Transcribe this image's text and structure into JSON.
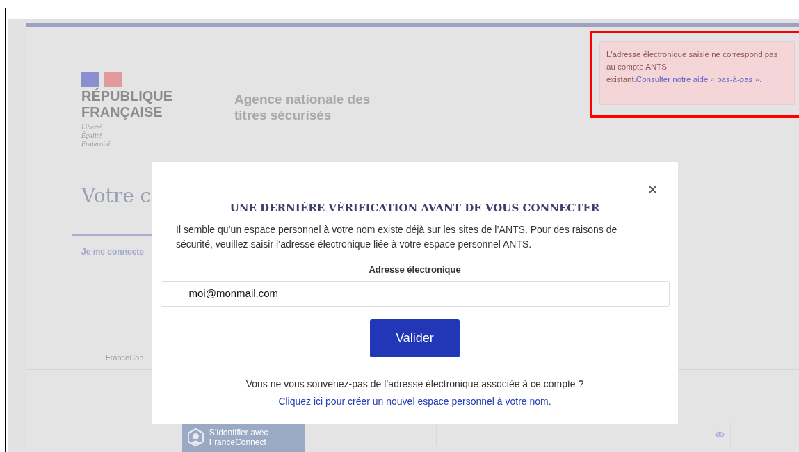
{
  "background_page": {
    "logo": {
      "name": "RÉPUBLIQUE FRANÇAISE",
      "motto": [
        "Liberté",
        "Égalité",
        "Fraternité"
      ]
    },
    "agency": "Agence nationale des titres sécurisés",
    "heading": "Votre c",
    "tabs": [
      {
        "label": "Je me connecte",
        "selected": true
      }
    ],
    "franceconnect_label": "FranceCon",
    "franceconnect_button": "S’identifier avec FranceConnect"
  },
  "alert": {
    "text": "L'adresse électronique saisie ne correspond pas au compte ANTS existant.",
    "link": "Consulter notre aide « pas-à-pas »."
  },
  "modal": {
    "title": "UNE DERNIÈRE VÉRIFICATION AVANT DE VOUS CONNECTER",
    "description": "Il semble qu’un espace personnel à votre nom existe déjà sur les sites de l’ANTS. Pour des raisons de sécurité, veuillez saisir l’adresse électronique liée à votre espace personnel ANTS.",
    "field": {
      "label": "Adresse électronique",
      "value": "moi@monmail.com"
    },
    "submit": "Valider",
    "help": "Vous ne vous souvenez-pas de l’adresse électronique associée à ce compte ?",
    "link": "Cliquez ici pour créer un nouvel espace personnel à votre nom."
  }
}
